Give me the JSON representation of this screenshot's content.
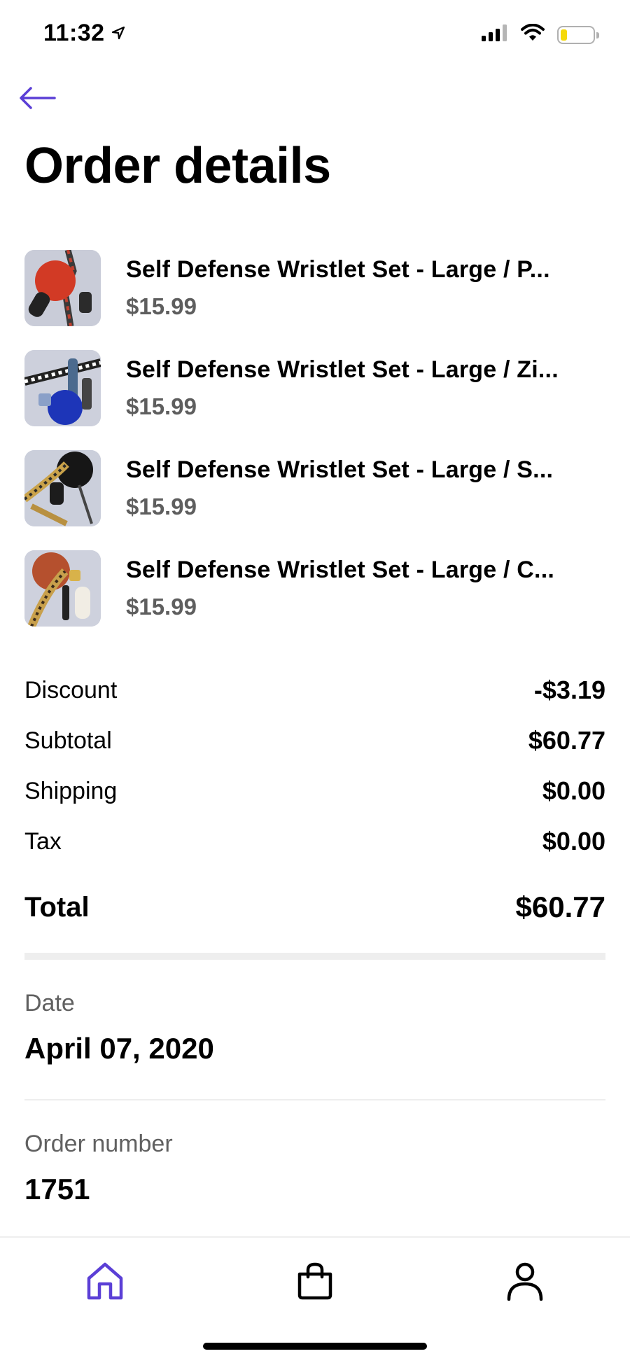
{
  "status_bar": {
    "time": "11:32"
  },
  "colors": {
    "accent": "#5b3fd6",
    "muted_text": "#5e5e5e",
    "divider": "#eeeeee"
  },
  "header": {
    "back_icon": "arrow-left-icon",
    "title": "Order details"
  },
  "items": [
    {
      "name": "Self Defense Wristlet Set - Large / P...",
      "price": "$15.99"
    },
    {
      "name": "Self Defense Wristlet Set - Large / Zi...",
      "price": "$15.99"
    },
    {
      "name": "Self Defense Wristlet Set - Large / S...",
      "price": "$15.99"
    },
    {
      "name": "Self Defense Wristlet Set - Large / C...",
      "price": "$15.99"
    }
  ],
  "summary": {
    "discount_label": "Discount",
    "discount_value": "-$3.19",
    "subtotal_label": "Subtotal",
    "subtotal_value": "$60.77",
    "shipping_label": "Shipping",
    "shipping_value": "$0.00",
    "tax_label": "Tax",
    "tax_value": "$0.00",
    "total_label": "Total",
    "total_value": "$60.77"
  },
  "info": {
    "date_label": "Date",
    "date_value": "April 07, 2020",
    "order_number_label": "Order number",
    "order_number_value": "1751"
  },
  "tab_bar": {
    "tabs": [
      {
        "icon": "home-icon",
        "active": true
      },
      {
        "icon": "shopping-bag-icon",
        "active": false
      },
      {
        "icon": "person-icon",
        "active": false
      }
    ]
  }
}
